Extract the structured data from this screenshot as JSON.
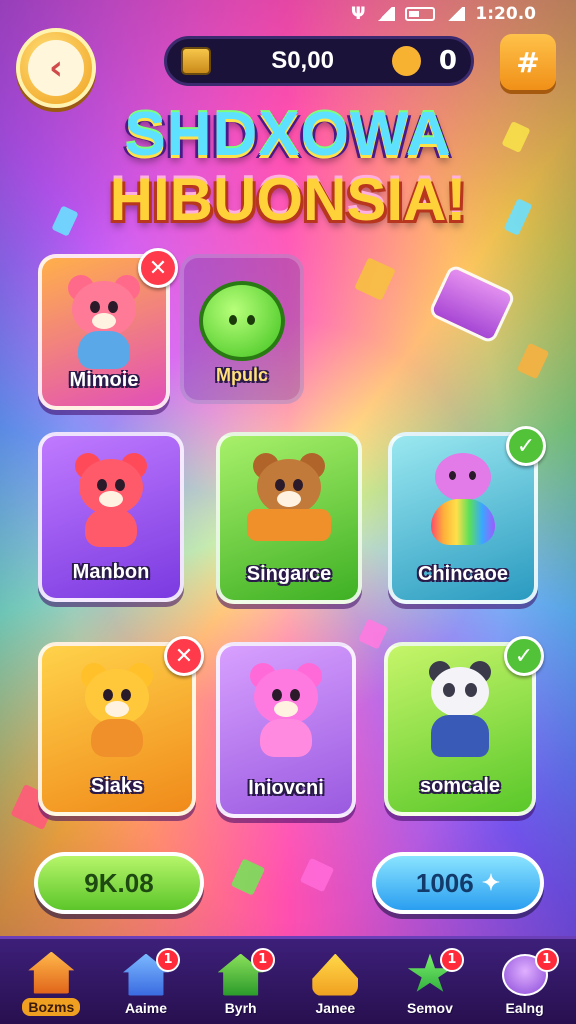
{
  "status_bar": {
    "time": "1:20.0",
    "network_glyph": "Ψ"
  },
  "top_bar": {
    "back_glyph": "‹",
    "coins": "S0,00",
    "gems": "0",
    "menu_glyph": "#"
  },
  "title": {
    "line1": "SHDXOWA",
    "line2": "HIBUONSIA!"
  },
  "cards": [
    {
      "name": "Mimoie",
      "badge": "✕",
      "color": "#e25fb4"
    },
    {
      "name": "Mpulc",
      "badge": "",
      "color": "#5a3aa0"
    },
    {
      "name": "Manbon",
      "badge": "",
      "color": "#8a4ce0"
    },
    {
      "name": "Singarce",
      "badge": "",
      "color": "#52c23a"
    },
    {
      "name": "Chincaoe",
      "badge": "✓",
      "color": "#3aa8c8"
    },
    {
      "name": "Siaks",
      "badge": "✕",
      "color": "#f0a020"
    },
    {
      "name": "Iniovcni",
      "badge": "",
      "color": "#9a5ae0"
    },
    {
      "name": "somcale",
      "badge": "✓",
      "color": "#6ad23a"
    }
  ],
  "buttons": {
    "left_label": "9K.08",
    "right_label": "1006",
    "right_sparkle": "✦"
  },
  "nav": [
    {
      "label": "Bozms",
      "badge": ""
    },
    {
      "label": "Aaime",
      "badge": "1"
    },
    {
      "label": "Byrh",
      "badge": "1"
    },
    {
      "label": "Janee",
      "badge": ""
    },
    {
      "label": "Semov",
      "badge": "1"
    },
    {
      "label": "Ealng",
      "badge": "1"
    }
  ]
}
